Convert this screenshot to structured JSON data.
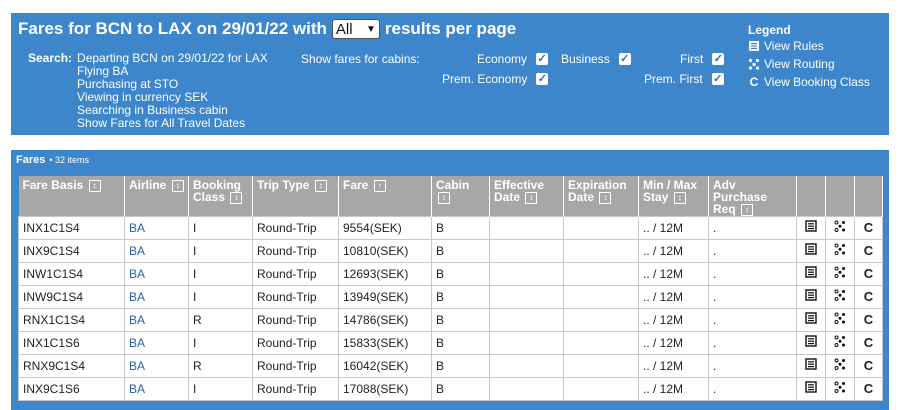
{
  "header": {
    "title_pre": "Fares for BCN to LAX on 29/01/22 with",
    "results_value": "All",
    "title_post": "results per page"
  },
  "search": {
    "label": "Search:",
    "lines": [
      "Departing BCN on 29/01/22 for LAX",
      "Flying BA",
      "Purchasing at STO",
      "Viewing in currency SEK",
      "Searching in Business cabin",
      "Show Fares for All Travel Dates"
    ]
  },
  "cabins": {
    "label": "Show fares for cabins:",
    "economy": "Economy",
    "business": "Business",
    "first": "First",
    "prem_economy": "Prem. Economy",
    "prem_first": "Prem. First"
  },
  "legend": {
    "title": "Legend",
    "view_rules": "View Rules",
    "view_routing": "View Routing",
    "view_booking": "View Booking Class"
  },
  "fares": {
    "title": "Fares",
    "count": "• 32 items"
  },
  "columns": {
    "fare_basis": "Fare Basis",
    "airline": "Airline",
    "booking_1": "Booking",
    "booking_2": "Class",
    "trip_type": "Trip Type",
    "fare": "Fare",
    "cabin": "Cabin",
    "effective_1": "Effective",
    "effective_2": "Date",
    "expiration_1": "Expiration",
    "expiration_2": "Date",
    "minmax_1": "Min / Max",
    "minmax_2": "Stay",
    "adv_1": "Adv Purchase",
    "adv_2": "Req"
  },
  "rows": [
    {
      "fb": "INX1C1S4",
      "al": "BA",
      "bc": "I",
      "tt": "Round-Trip",
      "fare": "9554(SEK)",
      "cab": "B",
      "eff": "",
      "exp": "",
      "mm": ".. / 12M",
      "adv": "."
    },
    {
      "fb": "INX9C1S4",
      "al": "BA",
      "bc": "I",
      "tt": "Round-Trip",
      "fare": "10810(SEK)",
      "cab": "B",
      "eff": "",
      "exp": "",
      "mm": ".. / 12M",
      "adv": "."
    },
    {
      "fb": "INW1C1S4",
      "al": "BA",
      "bc": "I",
      "tt": "Round-Trip",
      "fare": "12693(SEK)",
      "cab": "B",
      "eff": "",
      "exp": "",
      "mm": ".. / 12M",
      "adv": "."
    },
    {
      "fb": "INW9C1S4",
      "al": "BA",
      "bc": "I",
      "tt": "Round-Trip",
      "fare": "13949(SEK)",
      "cab": "B",
      "eff": "",
      "exp": "",
      "mm": ".. / 12M",
      "adv": "."
    },
    {
      "fb": "RNX1C1S4",
      "al": "BA",
      "bc": "R",
      "tt": "Round-Trip",
      "fare": "14786(SEK)",
      "cab": "B",
      "eff": "",
      "exp": "",
      "mm": ".. / 12M",
      "adv": "."
    },
    {
      "fb": "INX1C1S6",
      "al": "BA",
      "bc": "I",
      "tt": "Round-Trip",
      "fare": "15833(SEK)",
      "cab": "B",
      "eff": "",
      "exp": "",
      "mm": ".. / 12M",
      "adv": "."
    },
    {
      "fb": "RNX9C1S4",
      "al": "BA",
      "bc": "R",
      "tt": "Round-Trip",
      "fare": "16042(SEK)",
      "cab": "B",
      "eff": "",
      "exp": "",
      "mm": ".. / 12M",
      "adv": "."
    },
    {
      "fb": "INX9C1S6",
      "al": "BA",
      "bc": "I",
      "tt": "Round-Trip",
      "fare": "17088(SEK)",
      "cab": "B",
      "eff": "",
      "exp": "",
      "mm": ".. / 12M",
      "adv": "."
    }
  ]
}
